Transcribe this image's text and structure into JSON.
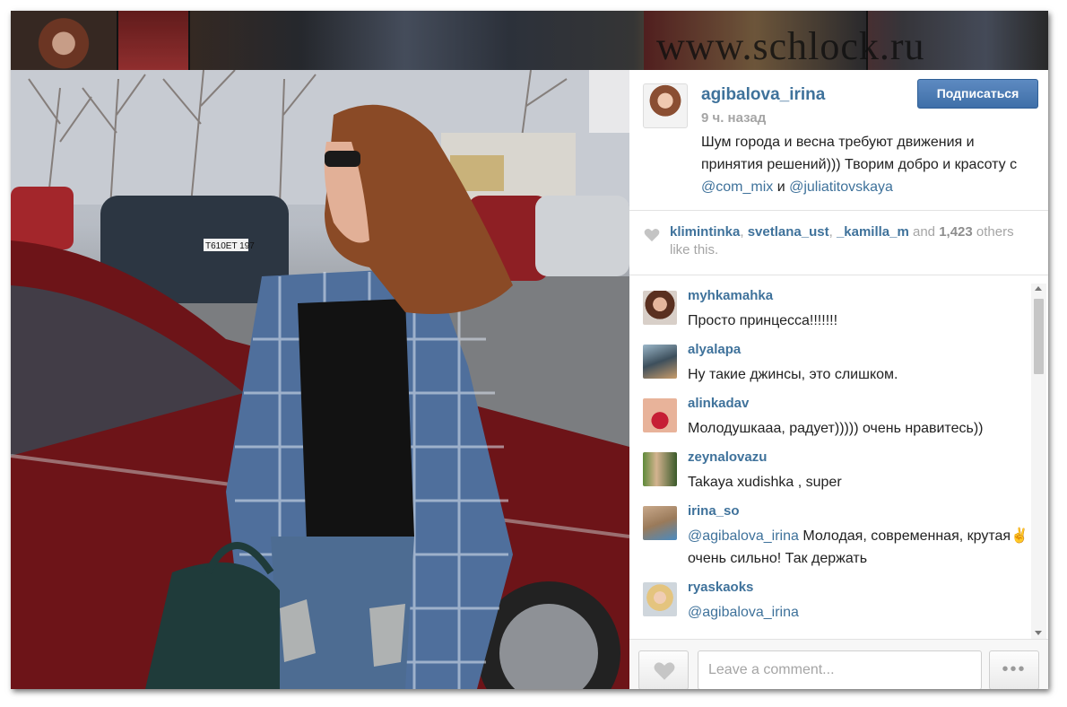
{
  "watermark": "www.schlock.ru",
  "post": {
    "username": "agibalova_irina",
    "time_ago": "9 ч. назад",
    "follow_label": "Подписаться",
    "caption_text": "Шум города и весна требуют движения и принятия решений))) Творим добро и красоту с ",
    "caption_mention_1": "@com_mix",
    "caption_and": " и ",
    "caption_mention_2": "@juliatitovskaya",
    "caption_end": " ",
    "photo_plate": "T610ET 197"
  },
  "likes": {
    "user_1": "klimintinka",
    "user_2": "svetlana_ust",
    "user_3": "_kamilla_m",
    "and_label": " and ",
    "count": "1,423",
    "suffix": " others like this."
  },
  "comments": [
    {
      "user": "myhkamahka",
      "mention": "",
      "text": "Просто принцесса!!!!!!!"
    },
    {
      "user": "alyalapa",
      "mention": "",
      "text": "Ну такие джинсы, это слишком."
    },
    {
      "user": "alinkadav",
      "mention": "",
      "text": "Молодушкааа, радует))))) очень нравитесь))"
    },
    {
      "user": "zeynalovazu",
      "mention": "",
      "text": "Takaya xudishka , super"
    },
    {
      "user": "irina_so",
      "mention": "@agibalova_irina",
      "text": " Молодая, современная, крутая✌очень сильно! Так держать"
    },
    {
      "user": "ryaskaoks",
      "mention": "@agibalova_irina",
      "text": " "
    }
  ],
  "footer": {
    "comment_placeholder": "Leave a comment...",
    "more_label": "•••"
  },
  "icons": {
    "like": "heart-icon",
    "more": "more-dots-icon"
  },
  "colors": {
    "link": "#3f729b",
    "follow_button": "#3f6fa8",
    "muted": "#a5a5a5"
  }
}
